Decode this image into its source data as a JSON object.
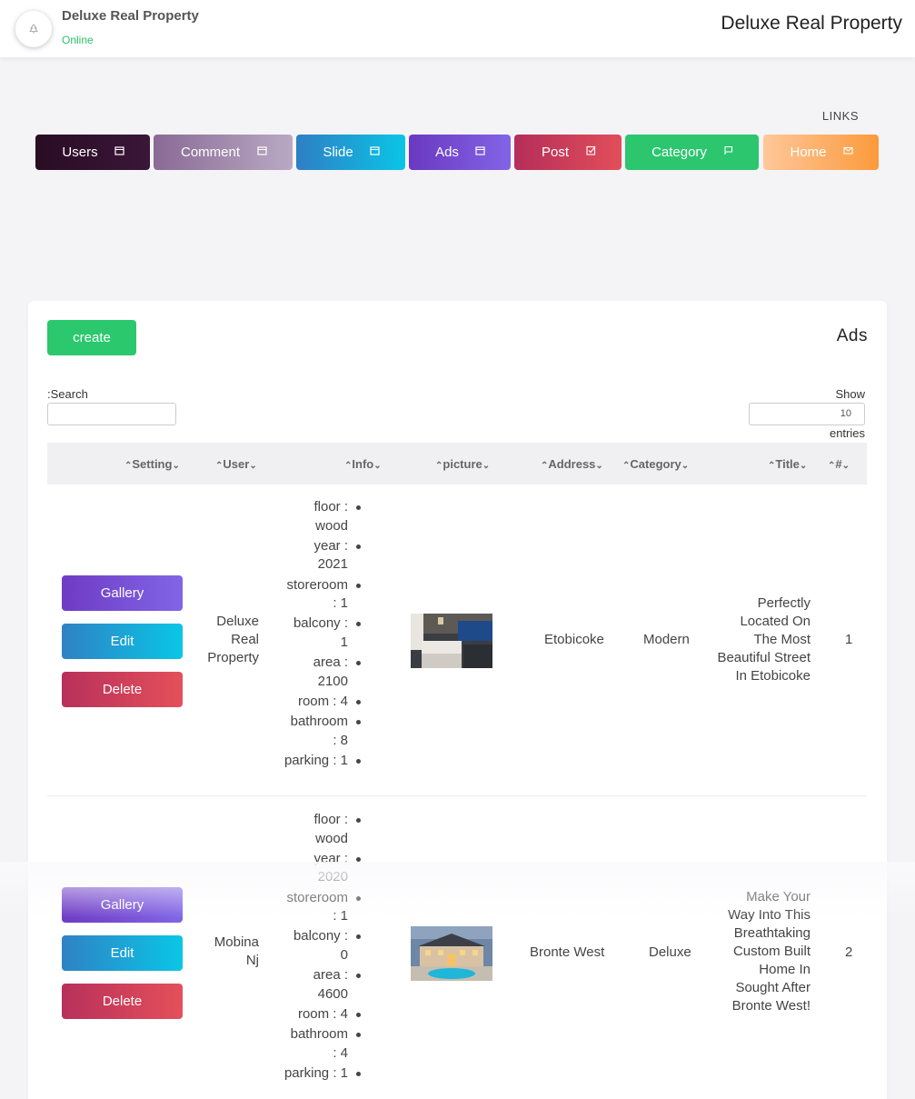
{
  "header": {
    "brand_name": "Deluxe Real Property",
    "status": "Online",
    "site_title": "Deluxe Real Property",
    "avatar_icon": "tree-logo-icon"
  },
  "links_label": "LINKS",
  "nav": [
    {
      "label": "Users",
      "icon": "calendar-icon"
    },
    {
      "label": "Comment",
      "icon": "calendar-icon"
    },
    {
      "label": "Slide",
      "icon": "calendar-icon"
    },
    {
      "label": "Ads",
      "icon": "calendar-icon"
    },
    {
      "label": "Post",
      "icon": "check-square-icon"
    },
    {
      "label": "Category",
      "icon": "flag-icon"
    },
    {
      "label": "Home",
      "icon": "mail-icon"
    }
  ],
  "card": {
    "create_label": "create",
    "title": "Ads",
    "search_label": ":Search",
    "search_value": "",
    "show_label": "Show",
    "show_value": "10",
    "entries_label": "entries"
  },
  "columns": [
    "Setting",
    "User",
    "Info",
    "picture",
    "Address",
    "Category",
    "Title",
    "#"
  ],
  "rows": [
    {
      "actions": {
        "gallery": "Gallery",
        "edit": "Edit",
        "delete": "Delete"
      },
      "user_lines": [
        "Deluxe",
        "Real",
        "Property"
      ],
      "info": [
        [
          "floor :",
          "wood"
        ],
        [
          "year :",
          "2021"
        ],
        [
          "storeroom",
          ": 1"
        ],
        [
          "balcony :",
          "1"
        ],
        [
          "area :",
          "2100"
        ],
        [
          "room : 4"
        ],
        [
          "bathroom",
          ": 8"
        ],
        [
          "parking : 1"
        ]
      ],
      "picture": "kitchen-photo",
      "address": "Etobicoke",
      "category": "Modern",
      "title_lines": [
        "Perfectly",
        "Located On",
        "The Most",
        "Beautiful Street",
        "In Etobicoke"
      ],
      "number": "1"
    },
    {
      "actions": {
        "gallery": "Gallery",
        "edit": "Edit",
        "delete": "Delete"
      },
      "user_lines": [
        "Mobina",
        "Nj"
      ],
      "info": [
        [
          "floor :",
          "wood"
        ],
        [
          "year :",
          "2020"
        ],
        [
          "storeroom",
          ": 1"
        ],
        [
          "balcony :",
          "0"
        ],
        [
          "area :",
          "4600"
        ],
        [
          "room : 4"
        ],
        [
          "bathroom",
          ": 4"
        ],
        [
          "parking : 1"
        ]
      ],
      "picture": "house-photo",
      "address": "Bronte West",
      "category": "Deluxe",
      "title_lines": [
        "Make Your",
        "Way Into This",
        "Breathtaking",
        "Custom Built",
        "Home In",
        "Sought After",
        "Bronte West!"
      ],
      "number": "2"
    }
  ]
}
